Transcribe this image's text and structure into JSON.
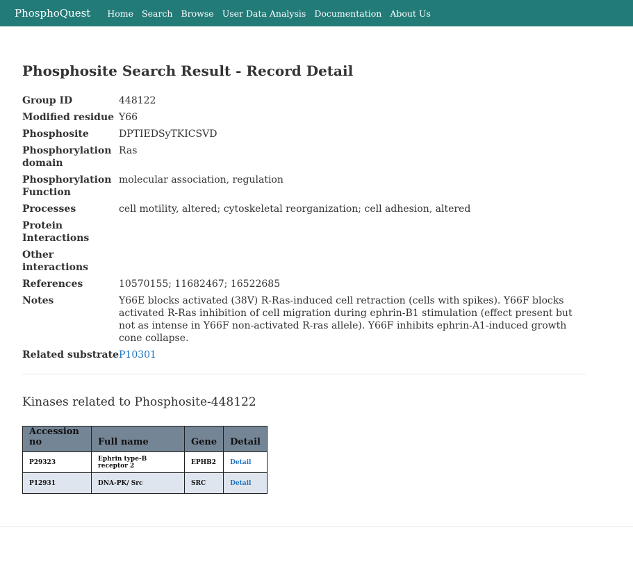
{
  "nav": {
    "brand": "PhosphoQuest",
    "links": [
      "Home",
      "Search",
      "Browse",
      "User Data Analysis",
      "Documentation",
      "About Us"
    ]
  },
  "page": {
    "title": "Phosphosite Search Result - Record Detail"
  },
  "record": [
    {
      "label": "Group ID",
      "value": "448122"
    },
    {
      "label": "Modified residue",
      "value": "Y66"
    },
    {
      "label": "Phosphosite",
      "value": "DPTIEDSyTKICSVD"
    },
    {
      "label": "Phosphorylation domain",
      "value": "Ras"
    },
    {
      "label": "Phosphorylation Function",
      "value": "molecular association, regulation"
    },
    {
      "label": "Processes",
      "value": "cell motility, altered; cytoskeletal reorganization; cell adhesion, altered"
    },
    {
      "label": "Protein Interactions",
      "value": ""
    },
    {
      "label": "Other interactions",
      "value": ""
    },
    {
      "label": "References",
      "value": "10570155; 11682467; 16522685"
    },
    {
      "label": "Notes",
      "value": "Y66E blocks activated (38V) R-Ras-induced cell retraction (cells with spikes). Y66F blocks activated R-Ras inhibition of cell migration during ephrin-B1 stimulation (effect present but not as intense in Y66F non-activated R-ras allele). Y66F inhibits ephrin-A1-induced growth cone collapse."
    },
    {
      "label": "Related substrate",
      "value": "P10301"
    }
  ],
  "kinases": {
    "title": "Kinases related to Phosphosite-448122",
    "headers": [
      "Accession no",
      "Full name",
      "Gene",
      "Detail"
    ],
    "rows": [
      {
        "accession": "P29323",
        "full_name": "Ephrin type-B receptor 2",
        "gene": "EPHB2",
        "detail": "Detail"
      },
      {
        "accession": "P12931",
        "full_name": "DNA-PK/ Src",
        "gene": "SRC",
        "detail": "Detail"
      }
    ]
  },
  "colors": {
    "navbar": "#237b78",
    "link": "#1e73be",
    "table_header": "#748596",
    "table_alt_row": "#dfe5ee"
  }
}
